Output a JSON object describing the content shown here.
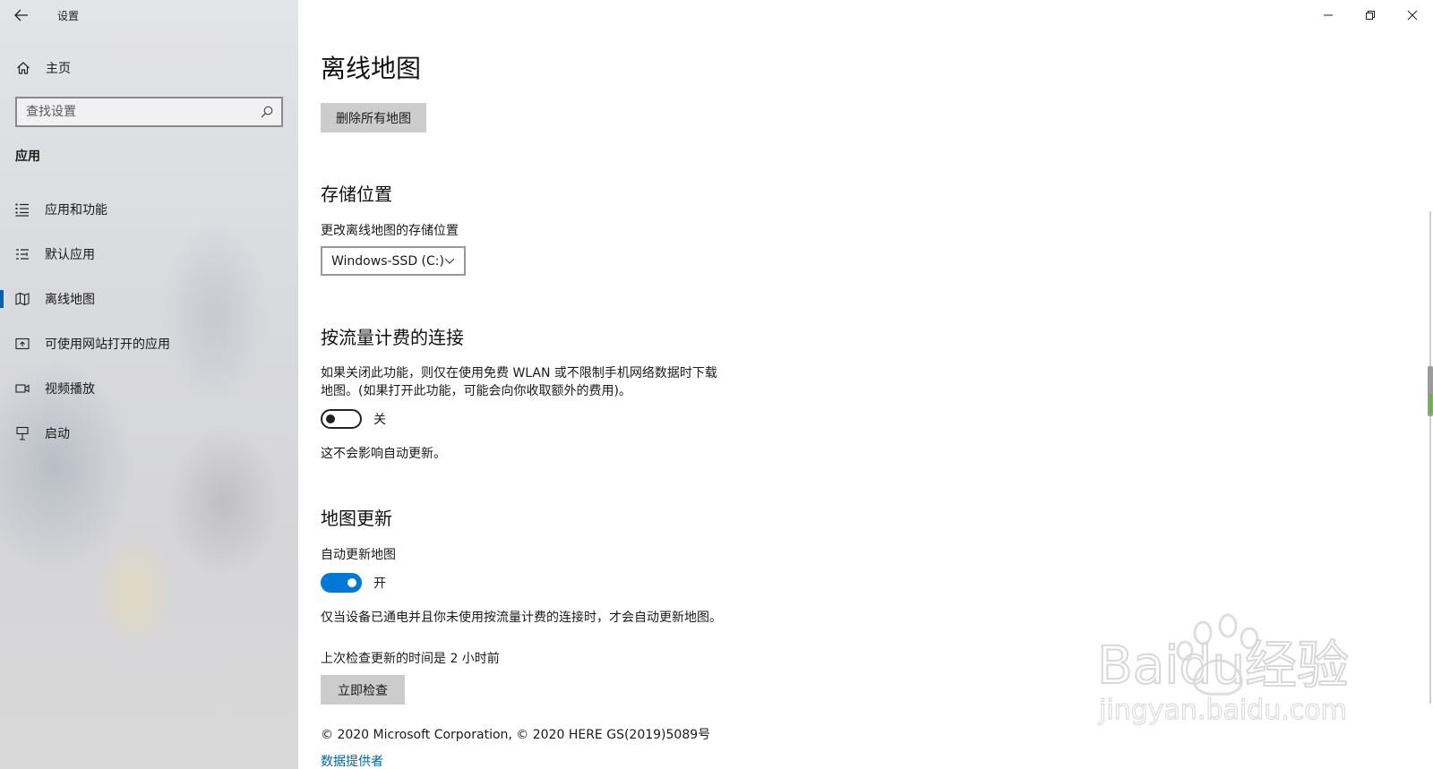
{
  "window": {
    "title": "设置"
  },
  "sidebar": {
    "home_label": "主页",
    "search_placeholder": "查找设置",
    "section_label": "应用",
    "items": [
      {
        "label": "应用和功能",
        "icon": "list-icon",
        "active": false
      },
      {
        "label": "默认应用",
        "icon": "default-apps-icon",
        "active": false
      },
      {
        "label": "离线地图",
        "icon": "map-icon",
        "active": true
      },
      {
        "label": "可使用网站打开的应用",
        "icon": "open-website-icon",
        "active": false
      },
      {
        "label": "视频播放",
        "icon": "video-icon",
        "active": false
      },
      {
        "label": "启动",
        "icon": "startup-icon",
        "active": false
      }
    ]
  },
  "main": {
    "title": "离线地图",
    "delete_all_label": "删除所有地图",
    "storage": {
      "heading": "存储位置",
      "label": "更改离线地图的存储位置",
      "selected": "Windows-SSD (C:)"
    },
    "metered": {
      "heading": "按流量计费的连接",
      "desc_line1": "如果关闭此功能，则仅在使用免费 WLAN 或不限制手机网络数据时下载",
      "desc_line2": "地图。(如果打开此功能，可能会向你收取额外的费用)。",
      "toggle_state": "关",
      "note": "这不会影响自动更新。"
    },
    "updates": {
      "heading": "地图更新",
      "auto_label": "自动更新地图",
      "toggle_state": "开",
      "note": "仅当设备已通电并且你未使用按流量计费的连接时，才会自动更新地图。",
      "last_checked": "上次检查更新的时间是 2 小时前",
      "check_now_label": "立即检查"
    },
    "copyright": "© 2020 Microsoft Corporation, © 2020 HERE GS(2019)5089号",
    "data_providers_link": "数据提供者"
  },
  "watermark": {
    "line1": "Baidu经验",
    "line2": "jingyan.baidu.com"
  },
  "colors": {
    "accent": "#0078d7",
    "link": "#0063b1",
    "button": "#cccccc"
  }
}
